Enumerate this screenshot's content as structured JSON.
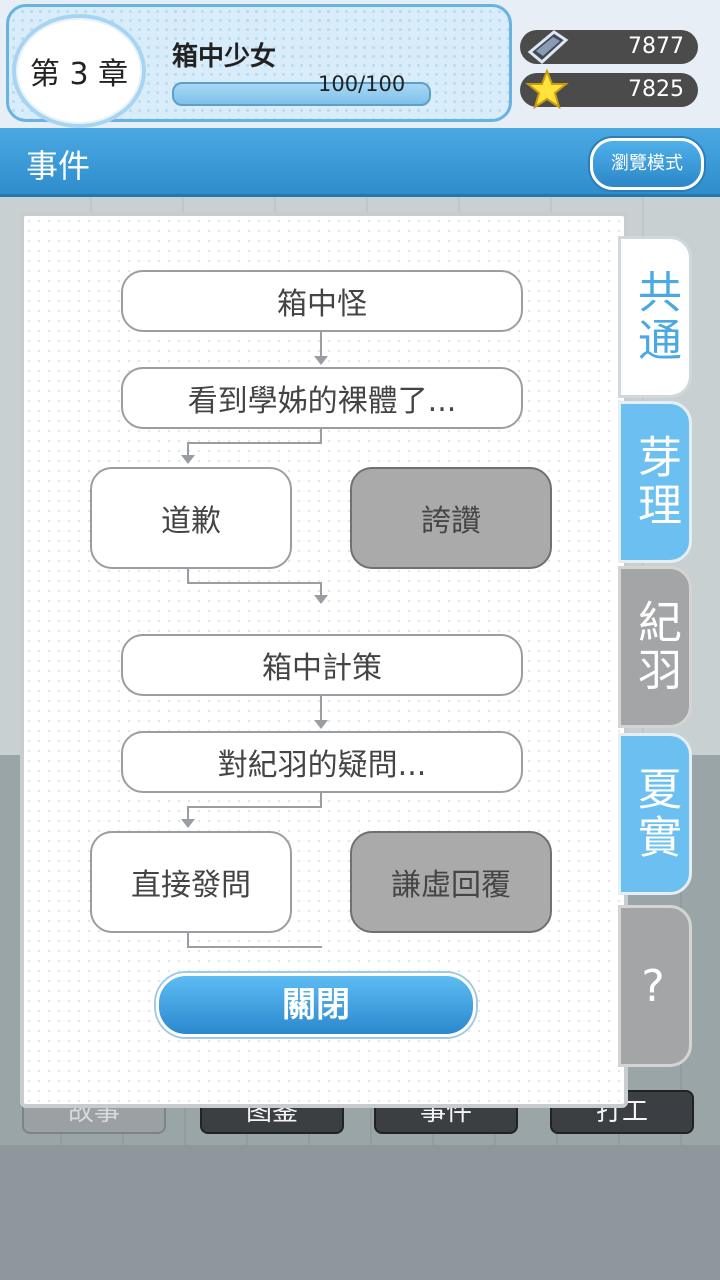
{
  "header": {
    "chapter_label": "第 3 章",
    "chapter_title": "箱中少女",
    "progress_text": "100/100",
    "progress_fraction": 1.0,
    "currency_gem": "7877",
    "currency_star": "7825"
  },
  "titlebar": {
    "title": "事件",
    "browse_label": "瀏覽模式"
  },
  "flow": {
    "node1": "箱中怪",
    "node2": "看到學姊的裸體了...",
    "choice1_left": "道歉",
    "choice1_right": "誇讚",
    "node3": "箱中計策",
    "node4": "對紀羽的疑問...",
    "choice2_left": "直接發問",
    "choice2_right": "謙虛回覆"
  },
  "close_label": "關閉",
  "tabs": [
    "共通",
    "芽理",
    "紀羽",
    "夏實",
    "?"
  ],
  "bottom_nav": [
    "故事",
    "图鉴",
    "事件",
    "打工"
  ],
  "colors": {
    "accent_blue": "#4aa8e3",
    "tab_blue": "#6cc0f1",
    "gray_choice": "#aaaaaa"
  }
}
